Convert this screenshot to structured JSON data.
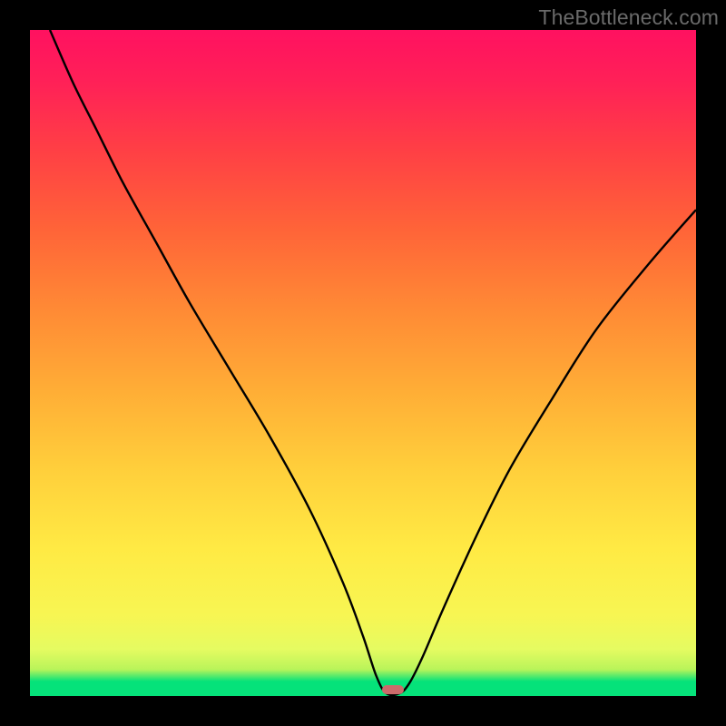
{
  "watermark": "TheBottleneck.com",
  "chart_data": {
    "type": "line",
    "title": "",
    "xlabel": "",
    "ylabel": "",
    "xlim": [
      0,
      100
    ],
    "ylim": [
      0,
      100
    ],
    "series": [
      {
        "name": "bottleneck-curve",
        "x": [
          3,
          6.5,
          10,
          14,
          19,
          24,
          30,
          36,
          42,
          47,
          50,
          52,
          53.5,
          55.5,
          57,
          59,
          62,
          67,
          72,
          78,
          85,
          93,
          100
        ],
        "values": [
          100,
          92,
          85,
          77,
          68,
          59,
          49,
          39,
          28,
          17,
          9,
          3,
          0.4,
          0.4,
          2,
          6,
          13,
          24,
          34,
          44,
          55,
          65,
          73
        ]
      }
    ],
    "marker": {
      "x": 54.5,
      "width_pct": 3.2
    },
    "background_gradient": {
      "stops": [
        {
          "pct": 0,
          "color": "#05e27a"
        },
        {
          "pct": 2.2,
          "color": "#05e27a"
        },
        {
          "pct": 4,
          "color": "#b9f45a"
        },
        {
          "pct": 7,
          "color": "#e5fb61"
        },
        {
          "pct": 12,
          "color": "#f7f653"
        },
        {
          "pct": 22,
          "color": "#ffea44"
        },
        {
          "pct": 34,
          "color": "#ffcf3b"
        },
        {
          "pct": 46,
          "color": "#ffad36"
        },
        {
          "pct": 58,
          "color": "#ff8a35"
        },
        {
          "pct": 70,
          "color": "#ff6438"
        },
        {
          "pct": 82,
          "color": "#ff3f45"
        },
        {
          "pct": 92,
          "color": "#ff2157"
        },
        {
          "pct": 100,
          "color": "#ff1160"
        }
      ]
    }
  }
}
